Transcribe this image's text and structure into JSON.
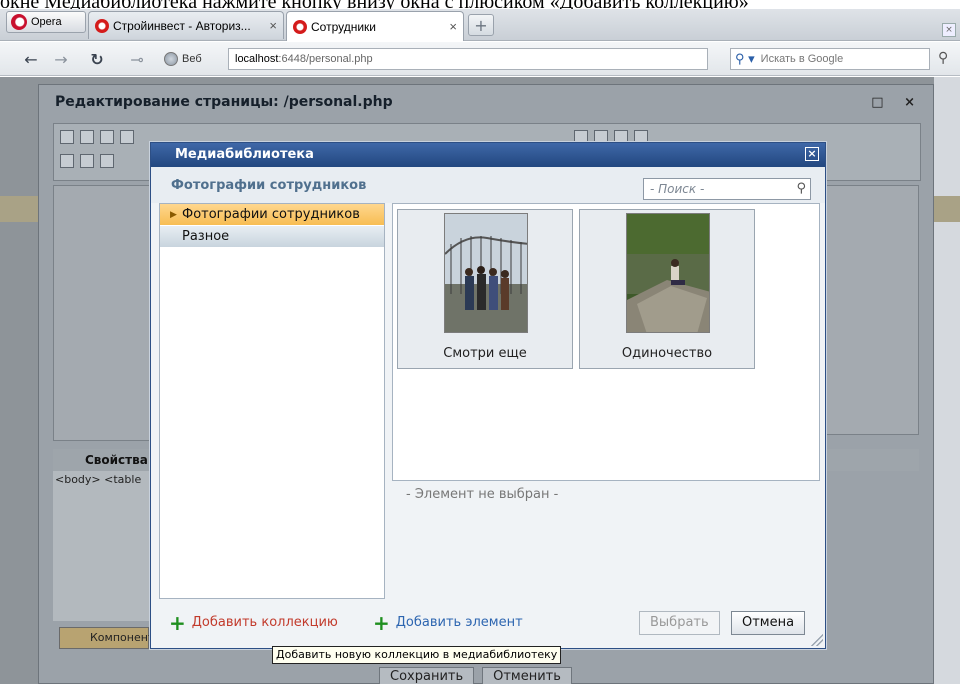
{
  "doc_strip": "окне Медиабиблиотека нажмите кнопку внизу окна с плюсиком «Добавить коллекцию»",
  "browser": {
    "opera_label": "Opera",
    "tabs": [
      {
        "label": "Стройинвест - Авториз..."
      },
      {
        "label": "Сотрудники"
      }
    ],
    "web_label": "Веб",
    "url_host": "localhost",
    "url_rest": ":6448/personal.php",
    "search_placeholder": "Искать в Google"
  },
  "editor": {
    "title": "Редактирование страницы: /personal.php",
    "window_controls": "□ ×",
    "props_title": "Свойства",
    "props_path": "<body> <table",
    "components_tab": "Компонент",
    "save_label": "Сохранить",
    "cancel_label": "Отменить"
  },
  "medialib": {
    "title": "Медиабиблиотека",
    "current_collection": "Фотографии сотрудников",
    "search_placeholder": "- Поиск -",
    "collections": [
      {
        "label": "Фотографии сотрудников",
        "selected": true
      },
      {
        "label": "Разное",
        "selected": false
      }
    ],
    "items": [
      {
        "caption": "Смотри еще"
      },
      {
        "caption": "Одиночество"
      }
    ],
    "no_selection": "- Элемент не выбран -",
    "add_collection": "Добавить коллекцию",
    "add_item": "Добавить элемент",
    "select_button": "Выбрать",
    "cancel_button": "Отмена",
    "tooltip": "Добавить новую коллекцию в медиабиблиотеку"
  },
  "colors": {
    "dialog_title_bg": "#22477f",
    "selected_collection": "#f7bd53",
    "add_collection_link": "#c23a2b",
    "add_item_link": "#2d65b0",
    "plus_icon": "#1f8f1f"
  }
}
